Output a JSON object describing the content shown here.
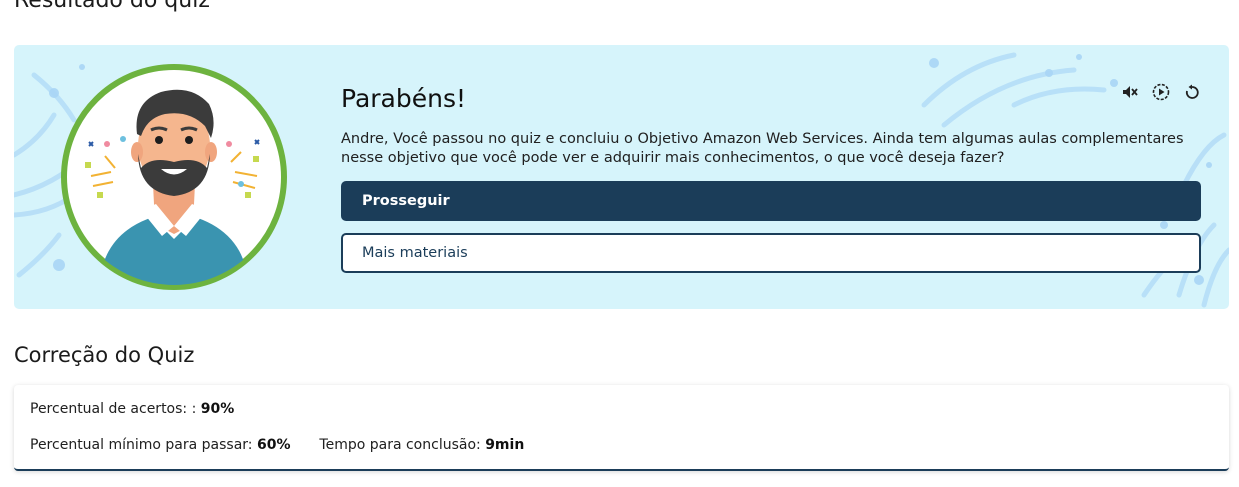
{
  "page": {
    "title": "Resultado do quiz"
  },
  "banner": {
    "heading": "Parabéns!",
    "message": "Andre, Você passou no quiz e concluiu o Objetivo Amazon Web Services. Ainda tem algumas aulas complementares nesse objetivo que você pode ver e adquirir mais conhecimentos, o que você deseja fazer?",
    "primary_button": "Prosseguir",
    "secondary_button": "Mais materiais",
    "controls": [
      "mute-icon",
      "play-icon",
      "replay-icon"
    ],
    "colors": {
      "background": "#d6f4fb",
      "primary": "#1b3d59",
      "avatar_ring": "#6db33f"
    }
  },
  "correction": {
    "title": "Correção do Quiz",
    "score_label": "Percentual de acertos: :",
    "score_value": "90%",
    "min_label": "Percentual mínimo para passar:",
    "min_value": "60%",
    "time_label": "Tempo para conclusão:",
    "time_value": "9min"
  }
}
